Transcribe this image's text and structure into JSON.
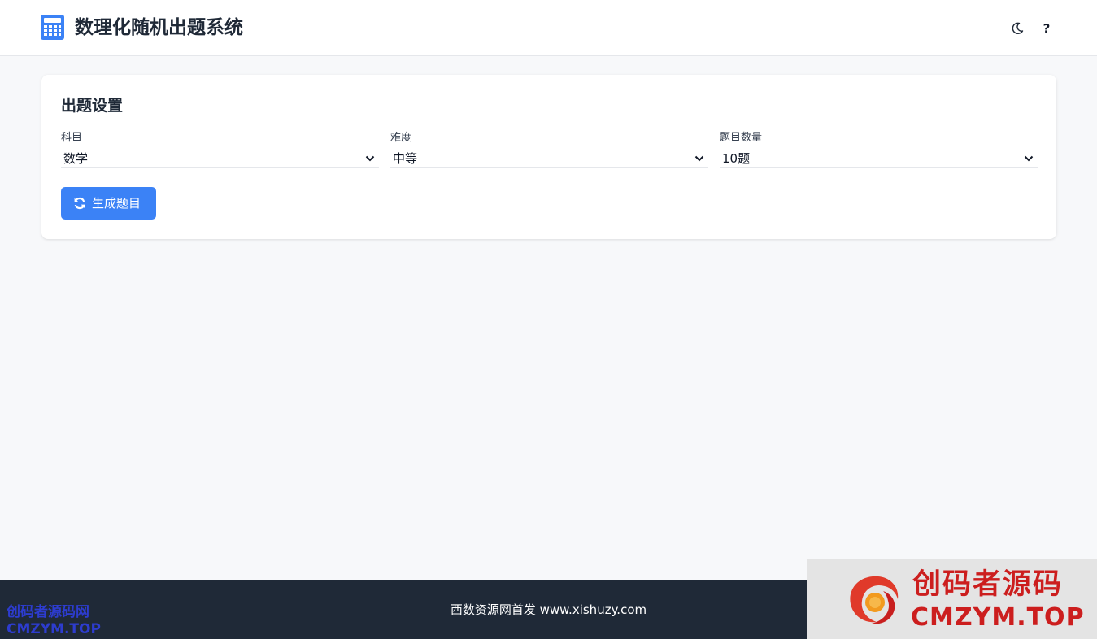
{
  "header": {
    "title": "数理化随机出题系统",
    "logo_icon": "calculator-icon",
    "theme_icon": "moon-icon",
    "help_label": "?"
  },
  "settings": {
    "title": "出题设置",
    "fields": [
      {
        "label": "科目",
        "value": "数学"
      },
      {
        "label": "难度",
        "value": "中等"
      },
      {
        "label": "题目数量",
        "value": "10题"
      }
    ],
    "generate_button": {
      "label": "生成题目",
      "icon": "sync-icon"
    }
  },
  "footer": {
    "text": "西数资源网首发 www.xishuzy.com"
  },
  "watermarks": {
    "left_line1": "创码者源码网",
    "left_line2": "CMZYM.TOP",
    "right_line1": "创码者源码",
    "right_line2": "CMZYM.TOP"
  },
  "colors": {
    "accent": "#3b82f6",
    "footer_bg": "#1f2937",
    "page_bg": "#f7f8fa",
    "watermark_red": "#cc1e1e",
    "watermark_blue": "#2d3ccf"
  }
}
